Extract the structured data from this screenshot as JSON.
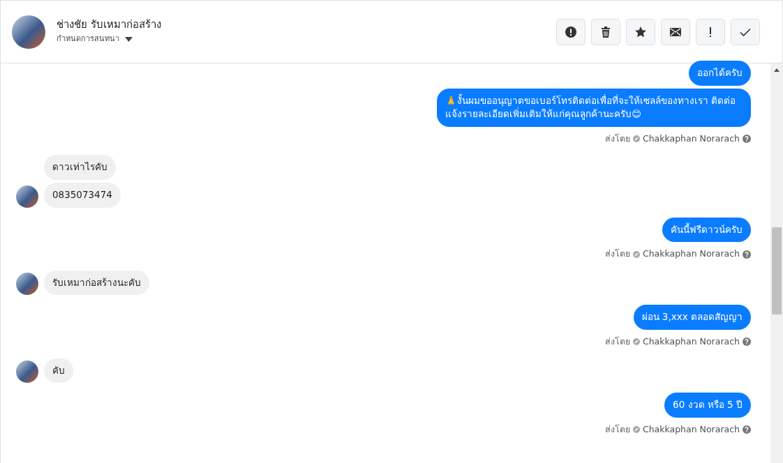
{
  "header": {
    "name": "ช่างชัย รับเหมาก่อสร้าง",
    "assign_label": "กำหนดการสนทนา",
    "actions": [
      {
        "kind": "spam"
      },
      {
        "kind": "delete"
      },
      {
        "kind": "star"
      },
      {
        "kind": "unread"
      },
      {
        "kind": "important"
      },
      {
        "kind": "done"
      }
    ]
  },
  "messages": [
    {
      "kind": "outgoing",
      "bubbles": [
        "ออกได้ครับ",
        "🙏งั้นผมขออนุญาตขอเบอร์โทรติดต่อเพื่อที่จะให้เซลล์ของทางเรา ติดต่อแจ้งรายละเอียดเพิ่มเติมให้แก่คุณลูกค้านะครับ😊"
      ],
      "sent_by": "ส่งโดย",
      "sender": "Chakkaphan Norarach"
    },
    {
      "kind": "incoming",
      "bubbles": [
        "ดาวเท่าไรคับ",
        "0835073474"
      ]
    },
    {
      "kind": "outgoing",
      "bubbles": [
        "คันนี้ฟรีดาวน์ครับ"
      ],
      "sent_by": "ส่งโดย",
      "sender": "Chakkaphan Norarach"
    },
    {
      "kind": "incoming",
      "bubbles": [
        "รับเหมาก่อสร้างนะคับ"
      ]
    },
    {
      "kind": "outgoing",
      "bubbles": [
        "ผ่อน 3,xxx ตลอดสัญญา"
      ],
      "sent_by": "ส่งโดย",
      "sender": "Chakkaphan Norarach"
    },
    {
      "kind": "incoming",
      "bubbles": [
        "คับ"
      ]
    },
    {
      "kind": "outgoing",
      "bubbles": [
        "60 งวด หรือ 5 ปี"
      ],
      "sent_by": "ส่งโดย",
      "sender": "Chakkaphan Norarach"
    }
  ]
}
